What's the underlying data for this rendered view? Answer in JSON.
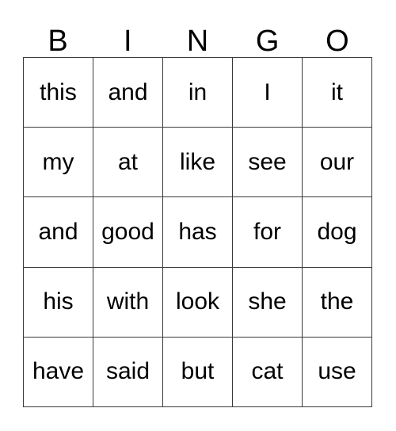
{
  "card": {
    "type": "bingo-card",
    "background_color": "#ffffff",
    "text_color": "#000000",
    "border_color": "#3a3a3a",
    "columns": 5,
    "rows": 5,
    "header": {
      "letters": [
        "B",
        "I",
        "N",
        "G",
        "O"
      ]
    },
    "grid": {
      "rows": [
        [
          "this",
          "and",
          "in",
          "I",
          "it"
        ],
        [
          "my",
          "at",
          "like",
          "see",
          "our"
        ],
        [
          "and",
          "good",
          "has",
          "for",
          "dog"
        ],
        [
          "his",
          "with",
          "look",
          "she",
          "the"
        ],
        [
          "have",
          "said",
          "but",
          "cat",
          "use"
        ]
      ]
    }
  }
}
